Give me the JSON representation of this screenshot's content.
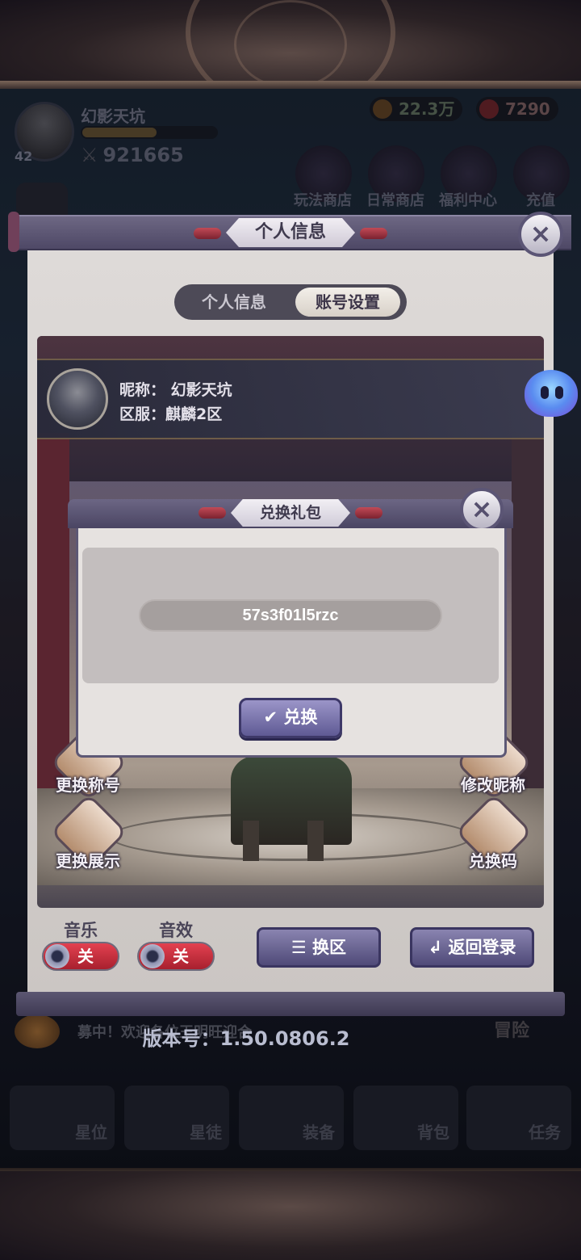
{
  "hud": {
    "player_name": "幻影天坑",
    "level": "42",
    "power": "921665",
    "gold": "22.3万",
    "gems": "7290",
    "shops": [
      "玩法商店",
      "日常商店",
      "福利中心",
      "充值"
    ]
  },
  "panel": {
    "title": "个人信息",
    "close": "×",
    "tabs": [
      {
        "label": "个人信息",
        "active": false
      },
      {
        "label": "账号设置",
        "active": true
      }
    ],
    "profile": {
      "nickname_label": "昵称：",
      "nickname": "幻影天坑",
      "server_label": "区服：",
      "server": "麒麟2区"
    },
    "scene_buttons": {
      "change_title": "更换称号",
      "change_nickname": "修改昵称",
      "change_display": "更换展示",
      "redeem_code": "兑换码"
    },
    "music_label": "音乐",
    "sfx_label": "音效",
    "off_label": "关",
    "switch_server": "☰ 换区",
    "back_to_login": "↲ 返回登录"
  },
  "dialog": {
    "title": "兑换礼包",
    "close": "×",
    "code_value": "57s3f01l5rzc",
    "redeem_label": "✔ 兑换"
  },
  "ticker": "募中！欢迎各位王明旺迎合",
  "adventure": "冒险",
  "version": "版本号：1.50.0806.2",
  "nav": [
    "星位",
    "星徒",
    "装备",
    "背包",
    "任务"
  ],
  "colors": {
    "accent_purple": "#5f5a94",
    "toggle_red": "#e34150"
  }
}
